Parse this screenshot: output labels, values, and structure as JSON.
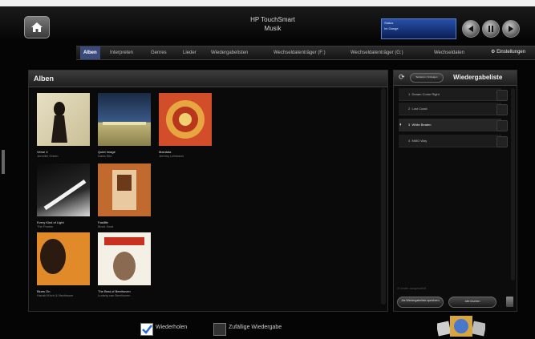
{
  "header": {
    "title_line1": "HP TouchSmart",
    "title_line2": "Musik"
  },
  "now_playing": {
    "line1": "Status",
    "line2": "Im Gange"
  },
  "tabs": [
    {
      "label": "Alben",
      "active": true
    },
    {
      "label": "Interpreten",
      "active": false
    },
    {
      "label": "Genres",
      "active": false
    },
    {
      "label": "Lieder",
      "active": false
    },
    {
      "label": "Wiedergabelisten",
      "active": false
    },
    {
      "label": "Wechseldatenträger (F:)",
      "active": false
    },
    {
      "label": "Wechseldatenträger (G:)",
      "active": false
    },
    {
      "label": "Wechseldaten",
      "active": false
    }
  ],
  "settings_label": "Einstellungen",
  "albums_panel": {
    "title": "Alben",
    "albums": [
      {
        "title": "Verse 4",
        "artist": "Jennifer Green"
      },
      {
        "title": "Quiet Image",
        "artist": "Darla Sitz"
      },
      {
        "title": "Mandala",
        "artist": "Jeremy Lehmann"
      },
      {
        "title": "Every Kind of Light",
        "artist": "The Posies"
      },
      {
        "title": "Fastlife",
        "artist": "Mock Haut"
      },
      {
        "title": "Blues On",
        "artist": "Harald Kirch & Nechtsam"
      },
      {
        "title": "The Best of Beethoven",
        "artist": "Ludwig van Beethoven"
      }
    ]
  },
  "playlist_panel": {
    "title": "Wiedergabeliste",
    "button_label": "Sortieren / Anzeigen",
    "tracks": [
      {
        "num": "1",
        "title": "Dream Come Right"
      },
      {
        "num": "2",
        "title": "Lost Coast"
      },
      {
        "num": "3",
        "title": "White Beaten"
      },
      {
        "num": "4",
        "title": "MMO Way"
      }
    ],
    "footer_text": "4 Lieder ausgewählt",
    "save_label": "Als Wiedergabeliste speichern",
    "clear_label": "Alle löschen"
  },
  "bottom": {
    "repeat_label": "Wiederholen",
    "repeat_checked": true,
    "shuffle_label": "Zufällige Wiedergabe",
    "shuffle_checked": false
  },
  "colors": {
    "accent_tab": "#3a4a7a",
    "now_playing_blue": "#2850a8"
  }
}
